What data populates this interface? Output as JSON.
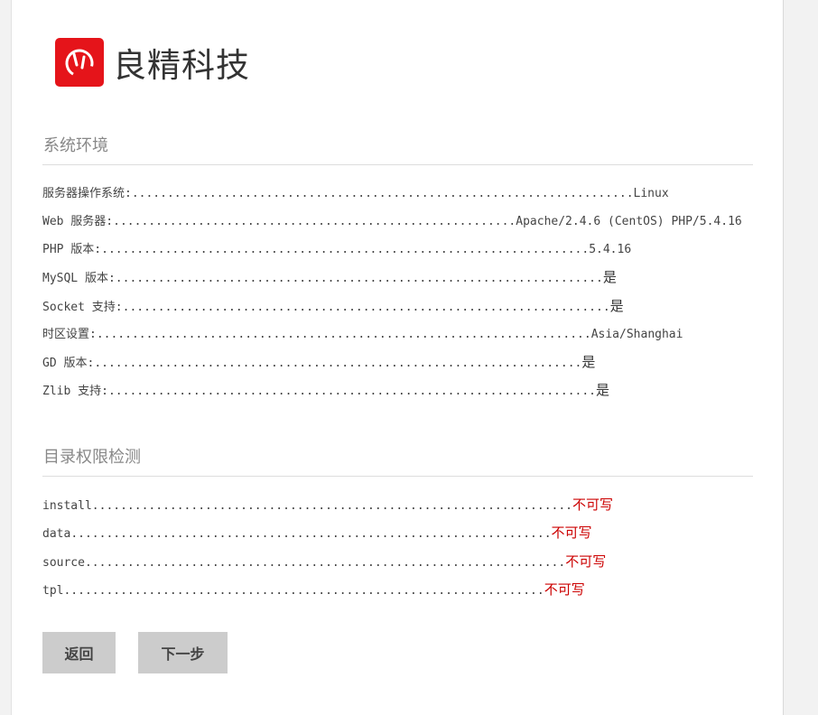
{
  "brand": {
    "name": "良精科技",
    "accent": "#e5141a"
  },
  "system_env": {
    "title": "系统环境",
    "items": [
      {
        "label": "服务器操作系统:",
        "value": "Linux"
      },
      {
        "label": "Web 服务器:",
        "value": "Apache/2.4.6 (CentOS) PHP/5.4.16"
      },
      {
        "label": "PHP 版本:",
        "value": "5.4.16"
      },
      {
        "label": "MySQL 版本:",
        "value": "是"
      },
      {
        "label": "Socket 支持:",
        "value": "是"
      },
      {
        "label": "时区设置:",
        "value": "Asia/Shanghai"
      },
      {
        "label": "GD 版本:",
        "value": "是"
      },
      {
        "label": "Zlib 支持:",
        "value": "是"
      }
    ]
  },
  "dir_check": {
    "title": "目录权限检测",
    "items": [
      {
        "label": "install ",
        "value": "不可写"
      },
      {
        "label": "data ",
        "value": "不可写"
      },
      {
        "label": "source ",
        "value": "不可写"
      },
      {
        "label": "tpl ",
        "value": "不可写"
      }
    ],
    "bad_color": "#cc0000"
  },
  "buttons": {
    "back": "返回",
    "next": "下一步"
  }
}
